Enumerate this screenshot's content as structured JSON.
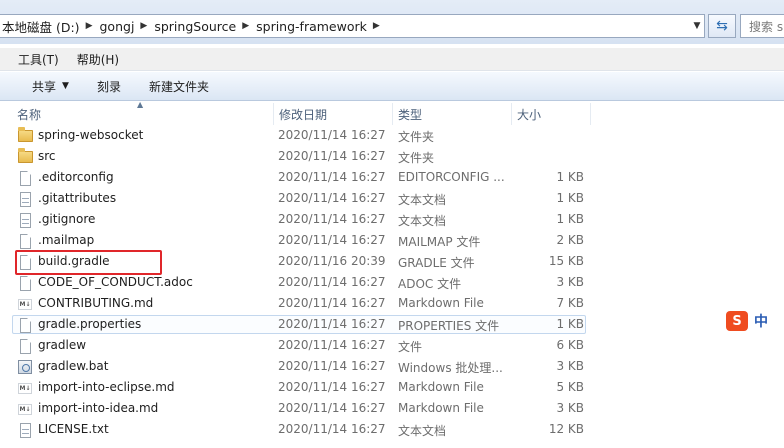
{
  "address": {
    "crumbs": [
      "本地磁盘 (D:)",
      "gongj",
      "springSource",
      "spring-framework"
    ],
    "search_placeholder": "搜索 s"
  },
  "menubar": {
    "items": [
      "工具(T)",
      "帮助(H)"
    ]
  },
  "commandbar": {
    "share": "共享",
    "burn": "刻录",
    "new_folder": "新建文件夹"
  },
  "columns": {
    "name": "名称",
    "modified": "修改日期",
    "type": "类型",
    "size": "大小"
  },
  "files": [
    {
      "name": "spring-websocket",
      "date": "2020/11/14 16:27",
      "type": "文件夹",
      "size": "",
      "icon": "folder-icon"
    },
    {
      "name": "src",
      "date": "2020/11/14 16:27",
      "type": "文件夹",
      "size": "",
      "icon": "folder-icon"
    },
    {
      "name": ".editorconfig",
      "date": "2020/11/14 16:27",
      "type": "EDITORCONFIG ...",
      "size": "1 KB",
      "icon": "file-icon"
    },
    {
      "name": ".gitattributes",
      "date": "2020/11/14 16:27",
      "type": "文本文档",
      "size": "1 KB",
      "icon": "text-file-icon"
    },
    {
      "name": ".gitignore",
      "date": "2020/11/14 16:27",
      "type": "文本文档",
      "size": "1 KB",
      "icon": "text-file-icon"
    },
    {
      "name": ".mailmap",
      "date": "2020/11/14 16:27",
      "type": "MAILMAP 文件",
      "size": "2 KB",
      "icon": "file-icon"
    },
    {
      "name": "build.gradle",
      "date": "2020/11/16 20:39",
      "type": "GRADLE 文件",
      "size": "15 KB",
      "icon": "file-icon"
    },
    {
      "name": "CODE_OF_CONDUCT.adoc",
      "date": "2020/11/14 16:27",
      "type": "ADOC 文件",
      "size": "3 KB",
      "icon": "file-icon"
    },
    {
      "name": "CONTRIBUTING.md",
      "date": "2020/11/14 16:27",
      "type": "Markdown File",
      "size": "7 KB",
      "icon": "markdown-file-icon"
    },
    {
      "name": "gradle.properties",
      "date": "2020/11/14 16:27",
      "type": "PROPERTIES 文件",
      "size": "1 KB",
      "icon": "file-icon"
    },
    {
      "name": "gradlew",
      "date": "2020/11/14 16:27",
      "type": "文件",
      "size": "6 KB",
      "icon": "file-icon"
    },
    {
      "name": "gradlew.bat",
      "date": "2020/11/14 16:27",
      "type": "Windows 批处理...",
      "size": "3 KB",
      "icon": "batch-file-icon"
    },
    {
      "name": "import-into-eclipse.md",
      "date": "2020/11/14 16:27",
      "type": "Markdown File",
      "size": "5 KB",
      "icon": "markdown-file-icon"
    },
    {
      "name": "import-into-idea.md",
      "date": "2020/11/14 16:27",
      "type": "Markdown File",
      "size": "3 KB",
      "icon": "markdown-file-icon"
    },
    {
      "name": "LICENSE.txt",
      "date": "2020/11/14 16:27",
      "type": "文本文档",
      "size": "12 KB",
      "icon": "text-file-icon"
    }
  ],
  "ime": {
    "label": "中"
  },
  "colors": {
    "highlight_box": "#e0262a",
    "selection_border": "#c3d7ee"
  }
}
